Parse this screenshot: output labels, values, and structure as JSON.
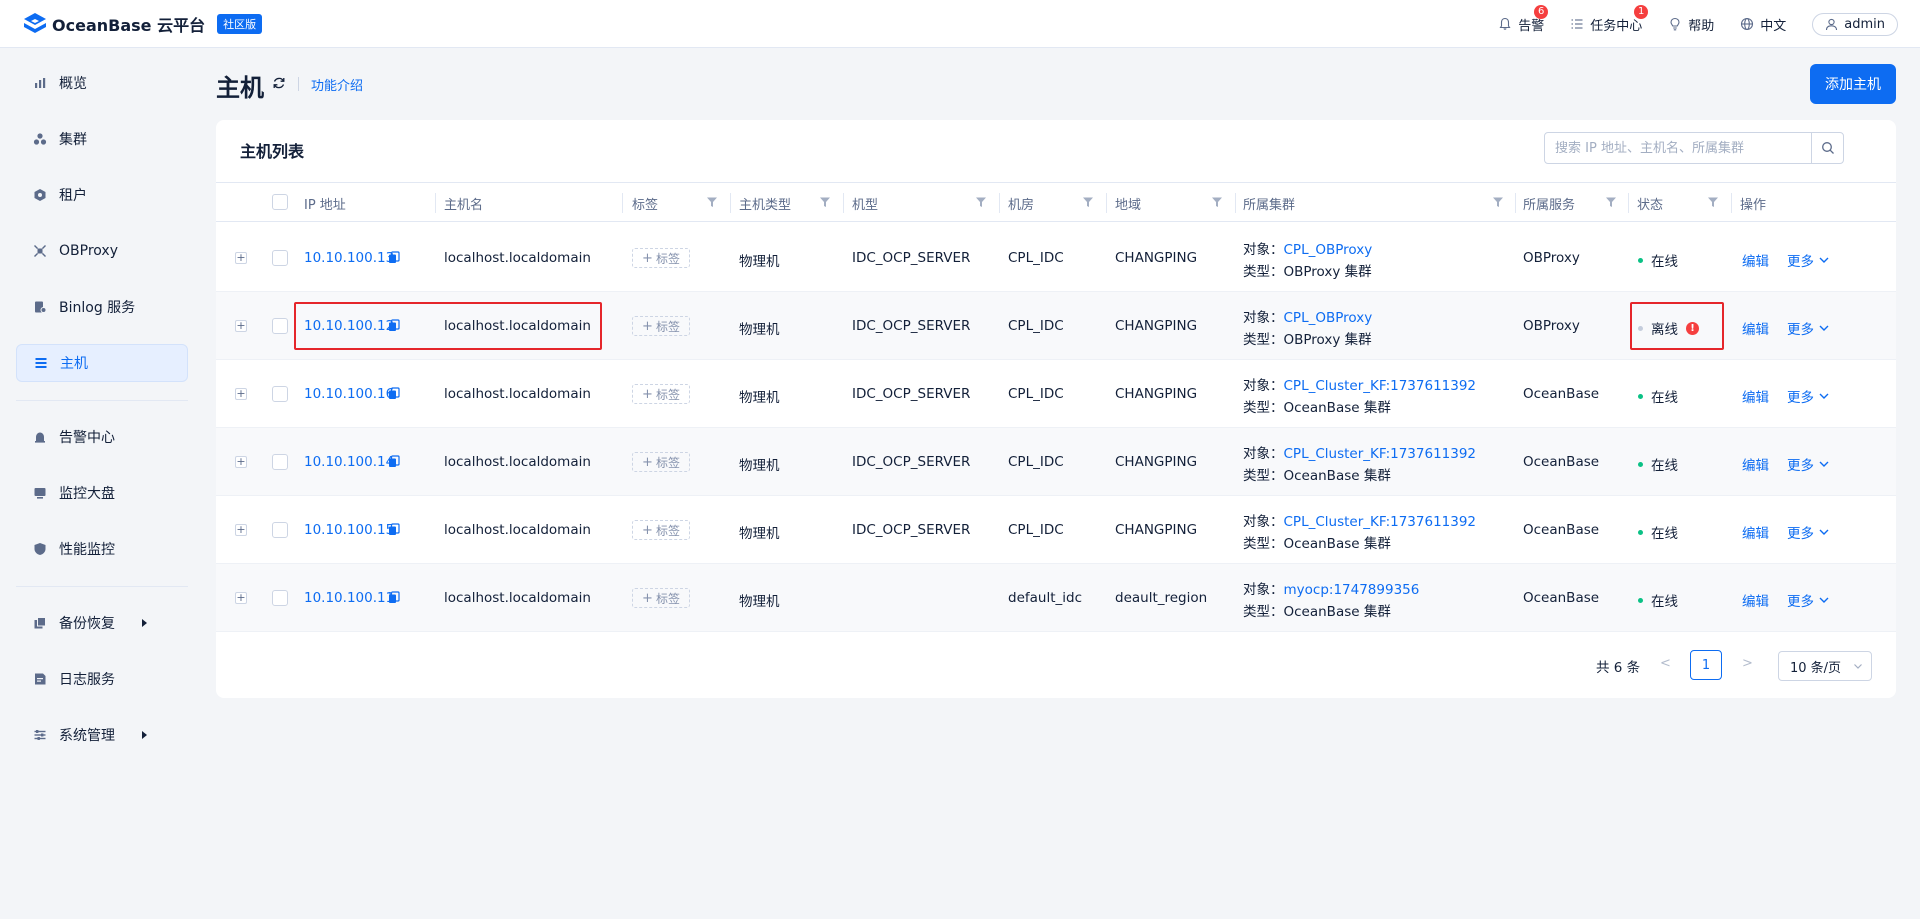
{
  "app": {
    "name": "OceanBase 云平台",
    "edition": "社区版"
  },
  "topbar": {
    "alerts": {
      "label": "告警",
      "count": "6"
    },
    "tasks": {
      "label": "任务中心",
      "count": "1"
    },
    "help": "帮助",
    "language": "中文",
    "user": "admin"
  },
  "sidebar": {
    "items": [
      {
        "label": "概览",
        "icon": "bar-chart-icon"
      },
      {
        "label": "集群",
        "icon": "cluster-icon"
      },
      {
        "label": "租户",
        "icon": "tenant-icon"
      },
      {
        "label": "OBProxy",
        "icon": "obproxy-icon"
      },
      {
        "label": "Binlog 服务",
        "icon": "binlog-icon"
      },
      {
        "label": "主机",
        "icon": "list-icon",
        "active": true
      },
      {
        "label": "告警中心",
        "icon": "alarm-icon"
      },
      {
        "label": "监控大盘",
        "icon": "monitor-icon"
      },
      {
        "label": "性能监控",
        "icon": "shield-icon"
      },
      {
        "label": "备份恢复",
        "icon": "backup-icon"
      },
      {
        "label": "日志服务",
        "icon": "log-icon"
      },
      {
        "label": "系统管理",
        "icon": "settings-icon"
      }
    ]
  },
  "page": {
    "title": "主机",
    "feature_link": "功能介绍",
    "add_button": "添加主机"
  },
  "table": {
    "title": "主机列表",
    "search_placeholder": "搜索 IP 地址、主机名、所属集群",
    "columns": [
      "IP 地址",
      "主机名",
      "标签",
      "主机类型",
      "机型",
      "机房",
      "地域",
      "所属集群",
      "所属服务",
      "状态",
      "操作"
    ],
    "object_prefix": "对象：",
    "type_prefix": "类型：",
    "tag_label": "标签",
    "edit_label": "编辑",
    "more_label": "更多",
    "rows": [
      {
        "ip": "10.10.100.13",
        "hostname": "localhost.localdomain",
        "host_type": "物理机",
        "model": "IDC_OCP_SERVER",
        "idc": "CPL_IDC",
        "region": "CHANGPING",
        "cluster_object": "CPL_OBProxy",
        "cluster_type": "OBProxy 集群",
        "service": "OBProxy",
        "status": "在线",
        "online": true
      },
      {
        "ip": "10.10.100.12",
        "hostname": "localhost.localdomain",
        "host_type": "物理机",
        "model": "IDC_OCP_SERVER",
        "idc": "CPL_IDC",
        "region": "CHANGPING",
        "cluster_object": "CPL_OBProxy",
        "cluster_type": "OBProxy 集群",
        "service": "OBProxy",
        "status": "离线",
        "online": false,
        "warning": "!"
      },
      {
        "ip": "10.10.100.16",
        "hostname": "localhost.localdomain",
        "host_type": "物理机",
        "model": "IDC_OCP_SERVER",
        "idc": "CPL_IDC",
        "region": "CHANGPING",
        "cluster_object": "CPL_Cluster_KF:1737611392",
        "cluster_type": "OceanBase 集群",
        "service": "OceanBase",
        "status": "在线",
        "online": true
      },
      {
        "ip": "10.10.100.14",
        "hostname": "localhost.localdomain",
        "host_type": "物理机",
        "model": "IDC_OCP_SERVER",
        "idc": "CPL_IDC",
        "region": "CHANGPING",
        "cluster_object": "CPL_Cluster_KF:1737611392",
        "cluster_type": "OceanBase 集群",
        "service": "OceanBase",
        "status": "在线",
        "online": true
      },
      {
        "ip": "10.10.100.15",
        "hostname": "localhost.localdomain",
        "host_type": "物理机",
        "model": "IDC_OCP_SERVER",
        "idc": "CPL_IDC",
        "region": "CHANGPING",
        "cluster_object": "CPL_Cluster_KF:1737611392",
        "cluster_type": "OceanBase 集群",
        "service": "OceanBase",
        "status": "在线",
        "online": true
      },
      {
        "ip": "10.10.100.11",
        "hostname": "localhost.localdomain",
        "host_type": "物理机",
        "model": "",
        "idc": "default_idc",
        "region": "deault_region",
        "cluster_object": "myocp:1747899356",
        "cluster_type": "OceanBase 集群",
        "service": "OceanBase",
        "status": "在线",
        "online": true
      }
    ]
  },
  "pagination": {
    "total": "共 6 条",
    "prev": "<",
    "current": "1",
    "next": ">",
    "page_size": "10 条/页"
  },
  "colors": {
    "primary": "#0d6cf2",
    "online": "#0ac185",
    "danger": "#f53f3f",
    "highlight": "#e5262b"
  }
}
